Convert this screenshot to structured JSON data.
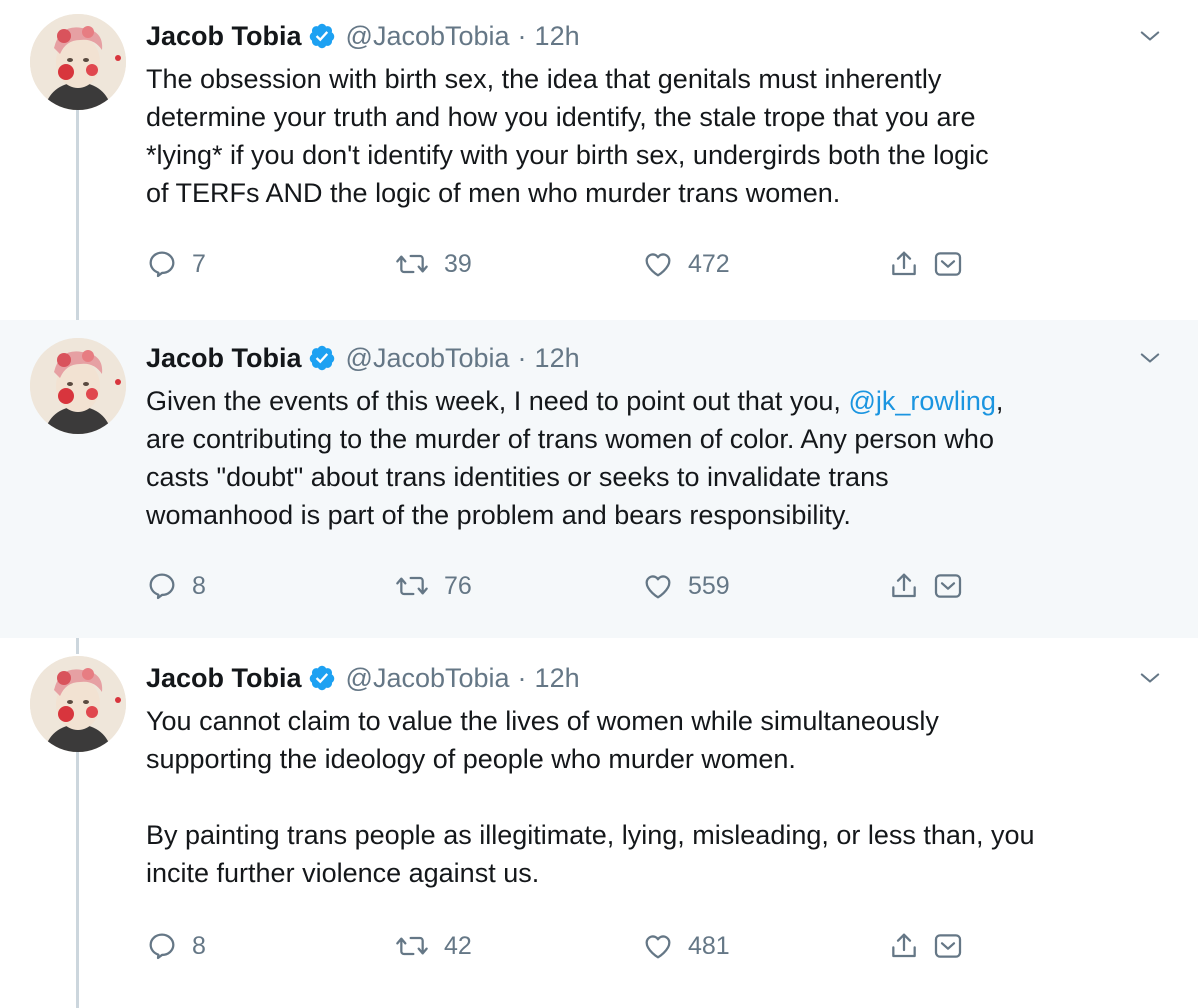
{
  "colors": {
    "accent": "#1da1f2",
    "mention": "#1b95e0",
    "text": "#14171a",
    "muted": "#657786",
    "highlight_bg": "#f5f8fa",
    "thread_line": "#ccd6dd"
  },
  "icons": {
    "reply": "reply-icon",
    "retweet": "retweet-icon",
    "like": "heart-icon",
    "share": "share-icon",
    "dm": "dm-icon",
    "caret": "chevron-down-icon",
    "verified": "verified-badge-icon"
  },
  "tweets": [
    {
      "name": "Jacob Tobia",
      "handle": "@JacobTobia",
      "separator": "·",
      "time": "12h",
      "lines": [
        "The obsession with birth sex, the idea that genitals must inherently",
        "determine your truth and how you identify, the stale trope that you are",
        "*lying* if you don't identify with your birth sex, undergirds both the logic",
        "of TERFs AND the logic of men who murder trans women."
      ],
      "replies": "7",
      "retweets": "39",
      "likes": "472"
    },
    {
      "name": "Jacob Tobia",
      "handle": "@JacobTobia",
      "separator": "·",
      "time": "12h",
      "line1_before": "Given the events of this week, I need to point out that you, ",
      "line1_mention": "@jk_rowling",
      "line1_after": ",",
      "lines": [
        "are contributing to the murder of trans women of color. Any person who",
        "casts \"doubt\" about trans identities or seeks to invalidate trans",
        "womanhood is part of the problem and bears responsibility."
      ],
      "replies": "8",
      "retweets": "76",
      "likes": "559"
    },
    {
      "name": "Jacob Tobia",
      "handle": "@JacobTobia",
      "separator": "·",
      "time": "12h",
      "lines": [
        "You cannot claim to value the lives of women while simultaneously",
        "supporting the ideology of people who murder women.",
        "By painting trans people as illegitimate, lying, misleading, or less than, you",
        "incite further violence against us."
      ],
      "replies": "8",
      "retweets": "42",
      "likes": "481"
    }
  ]
}
